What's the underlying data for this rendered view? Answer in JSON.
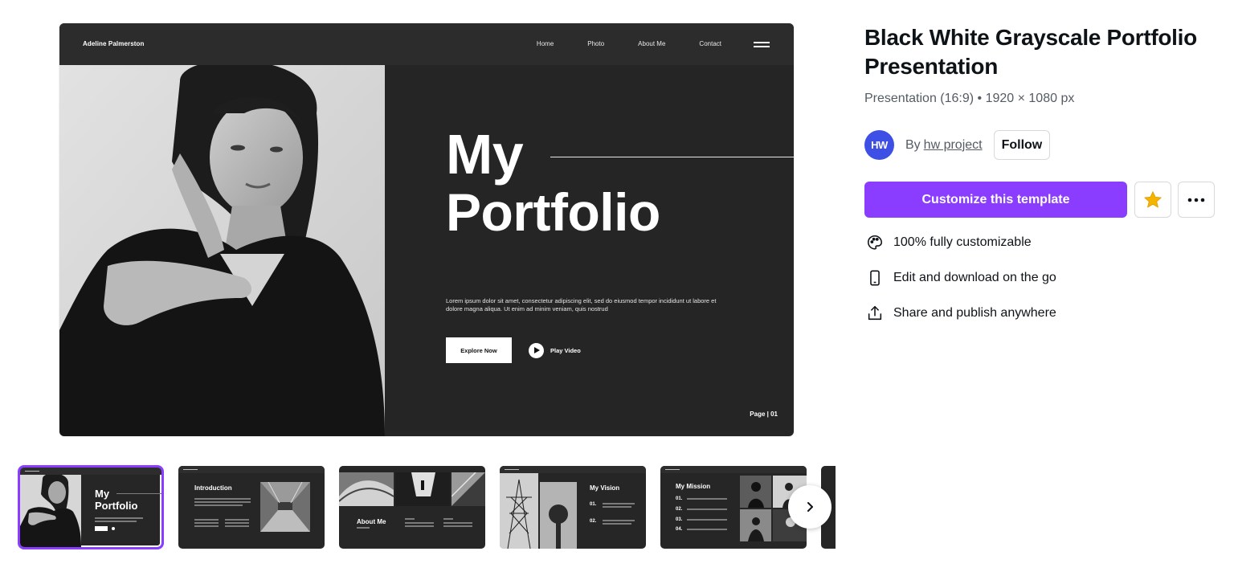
{
  "preview": {
    "brand": "Adeline Palmerston",
    "nav": [
      "Home",
      "Photo",
      "About Me",
      "Contact"
    ],
    "heading_line1": "My",
    "heading_line2": "Portfolio",
    "lorem": "Lorem ipsum dolor sit amet, consectetur adipiscing elit, sed do eiusmod tempor incididunt ut labore et dolore magna aliqua. Ut enim ad minim veniam, quis nostrud",
    "explore_label": "Explore Now",
    "play_label": "Play Video",
    "page_label": "Page | 01"
  },
  "thumbnails": [
    {
      "title_line1": "My",
      "title_line2": "Portfolio",
      "selected": true
    },
    {
      "title": "Introduction"
    },
    {
      "title": "About Me"
    },
    {
      "title": "My Vision",
      "items": [
        "01.",
        "02."
      ]
    },
    {
      "title": "My Mission",
      "items": [
        "01.",
        "02.",
        "03.",
        "04."
      ]
    }
  ],
  "template": {
    "title": "Black White Grayscale Portfolio Presentation",
    "meta": "Presentation (16:9) • 1920 × 1080 px",
    "author_initials": "HW",
    "by_label": "By",
    "author_name": "hw project",
    "follow_label": "Follow",
    "customize_label": "Customize this template",
    "features": [
      {
        "icon": "palette-icon",
        "label": "100% fully customizable"
      },
      {
        "icon": "mobile-icon",
        "label": "Edit and download on the go"
      },
      {
        "icon": "share-icon",
        "label": "Share and publish anywhere"
      }
    ]
  },
  "colors": {
    "accent": "#8b3dff",
    "avatar": "#3e4fe6",
    "slide_bg": "#252525",
    "star": "#f5b400"
  }
}
